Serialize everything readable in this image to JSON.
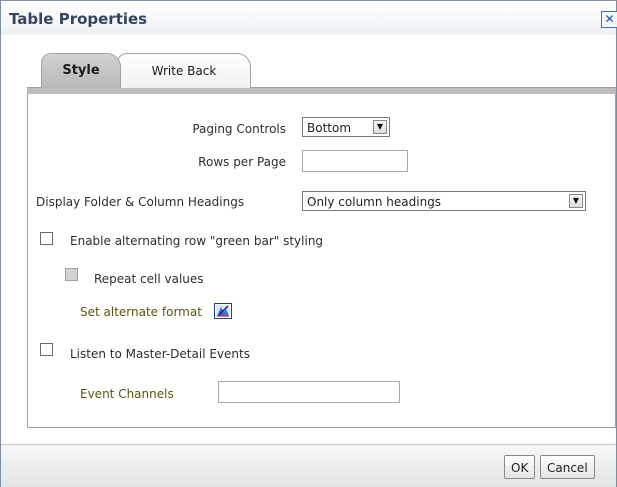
{
  "dialog": {
    "title": "Table Properties",
    "close_glyph": "✕"
  },
  "tabs": [
    {
      "label": "Style",
      "active": true
    },
    {
      "label": "Write Back",
      "active": false
    }
  ],
  "form": {
    "paging_controls": {
      "label": "Paging Controls",
      "value": "Bottom"
    },
    "rows_per_page": {
      "label": "Rows per Page",
      "value": ""
    },
    "display_headings": {
      "label": "Display Folder & Column Headings",
      "value": "Only column headings"
    },
    "green_bar": {
      "label": "Enable alternating row \"green bar\" styling",
      "checked": false
    },
    "repeat_cell": {
      "label": "Repeat cell values",
      "checked": false,
      "disabled": true
    },
    "alternate_format": {
      "label": "Set alternate format"
    },
    "master_detail": {
      "label": "Listen to Master-Detail Events",
      "checked": false
    },
    "event_channels": {
      "label": "Event Channels",
      "value": ""
    }
  },
  "footer": {
    "ok_label": "OK",
    "cancel_label": "Cancel"
  },
  "icons": {
    "dropdown_arrow": "▼",
    "format_icon": "edit-format-icon"
  },
  "colors": {
    "title_text": "#35455d",
    "label_olive": "#5c5310",
    "border": "#9aa3ad"
  }
}
